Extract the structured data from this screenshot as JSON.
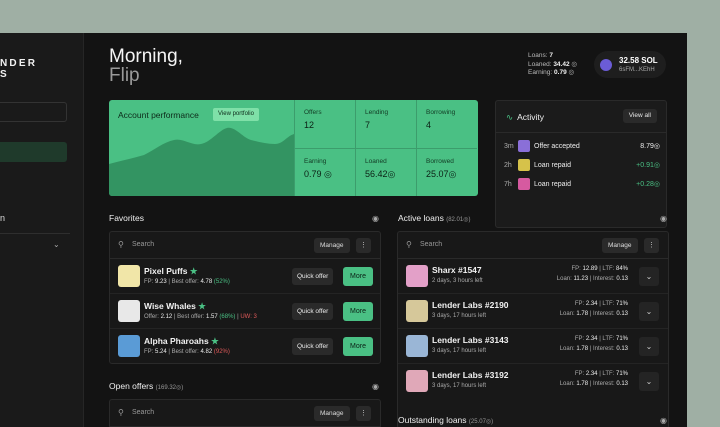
{
  "sidebar": {
    "brand_line1": "NDER",
    "brand_line2": "S",
    "cut_text": "n"
  },
  "greeting": {
    "line1": "Morning,",
    "line2": "Flip"
  },
  "stats": {
    "loans_label": "Loans:",
    "loans_value": "7",
    "loaned_label": "Loaned:",
    "loaned_value": "34.42",
    "earning_label": "Earning:",
    "earning_value": "0.79",
    "sol_sign": "◎"
  },
  "wallet": {
    "balance": "32.58 SOL",
    "address": "6sFM...KEhH"
  },
  "performance": {
    "title": "Account performance",
    "view_portfolio": "View portfolio",
    "cells": [
      {
        "label": "Offers",
        "value": "12"
      },
      {
        "label": "Lending",
        "value": "7"
      },
      {
        "label": "Borrowing",
        "value": "4"
      },
      {
        "label": "Earning",
        "value": "0.79 ◎"
      },
      {
        "label": "Loaned",
        "value": "56.42◎"
      },
      {
        "label": "Borrowed",
        "value": "25.07◎"
      }
    ]
  },
  "activity": {
    "title": "Activity",
    "view_all": "View all",
    "items": [
      {
        "time": "3m",
        "label": "Offer accepted",
        "amount": "8.79◎",
        "positive": false
      },
      {
        "time": "2h",
        "label": "Loan repaid",
        "amount": "+0.91◎",
        "positive": true
      },
      {
        "time": "7h",
        "label": "Loan repaid",
        "amount": "+0.28◎",
        "positive": true
      }
    ]
  },
  "favorites": {
    "title": "Favorites",
    "search_placeholder": "Search",
    "manage": "Manage",
    "items": [
      {
        "name": "Pixel Puffs",
        "fp": "9.23",
        "best": "4.78",
        "pct": "(52%)",
        "quick": "Quick offer",
        "more": "More"
      },
      {
        "name": "Wise Whales",
        "offer": "2.12",
        "best": "1.57",
        "pct": "(68%)",
        "uw": "UW: 3",
        "quick": "Quick offer",
        "more": "More"
      },
      {
        "name": "Alpha Pharoahs",
        "fp": "5.24",
        "best": "4.82",
        "pct": "(92%)",
        "quick": "Quick offer",
        "more": "More"
      }
    ]
  },
  "active_loans": {
    "title": "Active loans",
    "total": "(82.01◎)",
    "search_placeholder": "Search",
    "manage": "Manage",
    "items": [
      {
        "name": "Sharx #1547",
        "time": "2 days, 3 hours left",
        "fp": "12.89",
        "ltf": "84%",
        "loan": "11.23",
        "interest": "0.13"
      },
      {
        "name": "Lender Labs #2190",
        "time": "3 days, 17 hours left",
        "fp": "2.34",
        "ltf": "71%",
        "loan": "1.78",
        "interest": "0.13"
      },
      {
        "name": "Lender Labs #3143",
        "time": "3 days, 17 hours left",
        "fp": "2.34",
        "ltf": "71%",
        "loan": "1.78",
        "interest": "0.13"
      },
      {
        "name": "Lender Labs #3192",
        "time": "3 days, 17 hours left",
        "fp": "2.34",
        "ltf": "71%",
        "loan": "1.78",
        "interest": "0.13"
      }
    ]
  },
  "open_offers": {
    "title": "Open offers",
    "total": "(169.32◎)",
    "search_placeholder": "Search",
    "manage": "Manage"
  },
  "outstanding_loans": {
    "title": "Outstanding loans",
    "total": "(25.07◎)"
  },
  "colors": {
    "accent": "#4ac084",
    "background": "#131313",
    "negative": "#e05a5a"
  }
}
